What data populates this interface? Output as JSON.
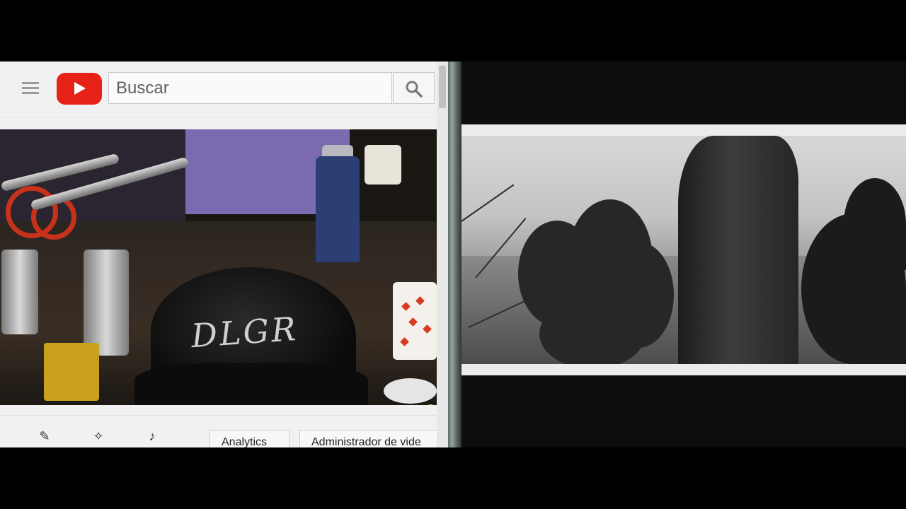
{
  "youtube": {
    "menu_icon": "hamburger-menu-icon",
    "logo_icon": "youtube-play-icon",
    "search": {
      "placeholder": "Buscar",
      "value": "",
      "button_icon": "search-icon"
    },
    "brand_color": "#e62117",
    "video_thumbnail": {
      "tag_text": "DLGR"
    },
    "toolbar": {
      "icons": [
        "pencil-icon",
        "magic-wand-icon",
        "music-note-icon"
      ],
      "analytics_label": "Analytics",
      "video_manager_label": "Administrador de vide"
    }
  },
  "right_player": {
    "scene": "grayscale-trees-landscape"
  }
}
